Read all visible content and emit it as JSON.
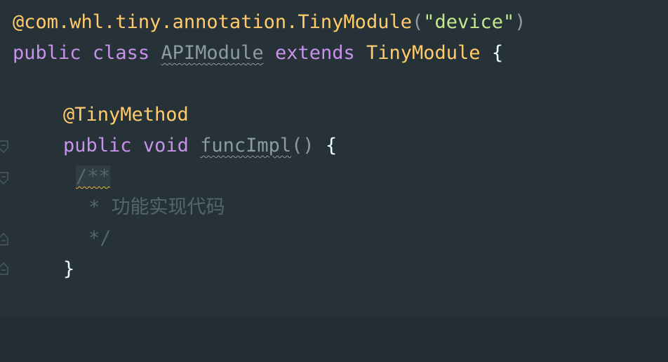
{
  "editor": {
    "lines": {
      "annotation": {
        "at": "@",
        "pkg": "com.whl.tiny.annotation.",
        "name": "TinyModule",
        "open": "(",
        "arg": "\"device\"",
        "close": ")"
      },
      "class_decl": {
        "kw_public": "public",
        "kw_class": "class",
        "class_name": "APIModule",
        "kw_extends": "extends",
        "parent": "TinyModule",
        "brace": "{"
      },
      "method_annotation": {
        "text": "@TinyMethod"
      },
      "method_decl": {
        "kw_public": "public",
        "kw_void": "void",
        "name": "funcImpl",
        "parens": "()",
        "brace": "{"
      },
      "comment_open": {
        "text": "/**"
      },
      "comment_body": {
        "star": "*",
        "text": "功能实现代码"
      },
      "comment_close": {
        "text": "*/"
      },
      "method_close": {
        "text": "}"
      }
    },
    "colors": {
      "background": "#263238",
      "keyword": "#c792ea",
      "class": "#ffcb6b",
      "string": "#c3e88d",
      "comment": "#54666d"
    }
  }
}
